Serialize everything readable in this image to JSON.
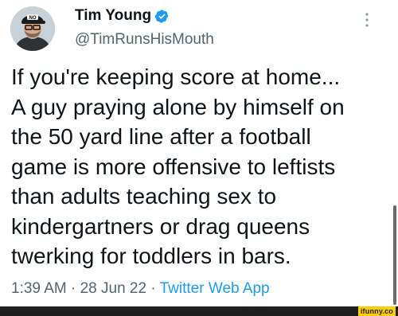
{
  "author": {
    "name": "Tim Young",
    "handle": "@TimRunsHisMouth",
    "verified": true,
    "cap_text": "NO"
  },
  "tweet": {
    "text": "If you're keeping score at home...\nA guy praying alone by himself on\nthe 50 yard line after a football\ngame is more offensive to leftists\nthan adults teaching sex to\nkindergartners or drag queens\ntwerking for toddlers in bars.",
    "time": "1:39 AM",
    "date": "28 Jun 22",
    "app": "Twitter Web App",
    "separator": "·"
  },
  "watermark": {
    "text": "ifunny.co"
  },
  "colors": {
    "verified_blue": "#1d9bf0",
    "secondary_text": "#536471",
    "primary_text": "#0f1419",
    "watermark_yellow": "#ffcc00"
  }
}
